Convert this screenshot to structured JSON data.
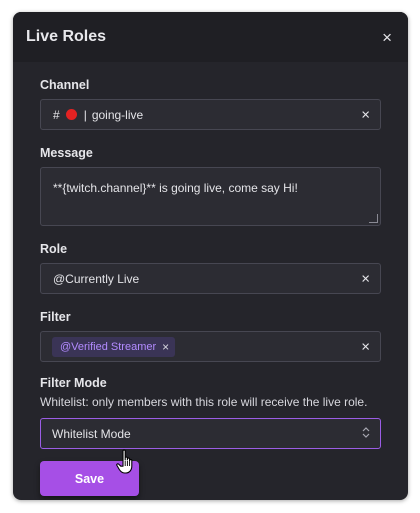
{
  "modal": {
    "title": "Live Roles",
    "close_glyph": "×"
  },
  "fields": {
    "channel": {
      "label": "Channel",
      "prefix": "#",
      "divider": "|",
      "value": "going-live",
      "clear_glyph": "×"
    },
    "message": {
      "label": "Message",
      "value": "**{twitch.channel}** is going live, come say Hi!"
    },
    "role": {
      "label": "Role",
      "value": "@Currently Live",
      "clear_glyph": "×"
    },
    "filter": {
      "label": "Filter",
      "tags": [
        {
          "label": "@Verified Streamer",
          "remove_glyph": "×"
        }
      ],
      "clear_glyph": "×"
    },
    "filter_mode": {
      "label": "Filter Mode",
      "description": "Whitelist: only members with this role will receive the live role.",
      "selected": "Whitelist Mode",
      "chevron_glyph": "⬍"
    }
  },
  "actions": {
    "save_label": "Save"
  },
  "colors": {
    "modal_bg": "#25252b",
    "header_bg": "#1f1f24",
    "accent": "#a64fe6",
    "live_dot": "#e32222",
    "tag_text": "#b38bff"
  },
  "icons": {
    "close": "close-icon",
    "clear": "clear-icon",
    "live_dot": "live-dot-icon",
    "chevron": "select-chevron-icon",
    "cursor": "hand-pointer-icon"
  }
}
